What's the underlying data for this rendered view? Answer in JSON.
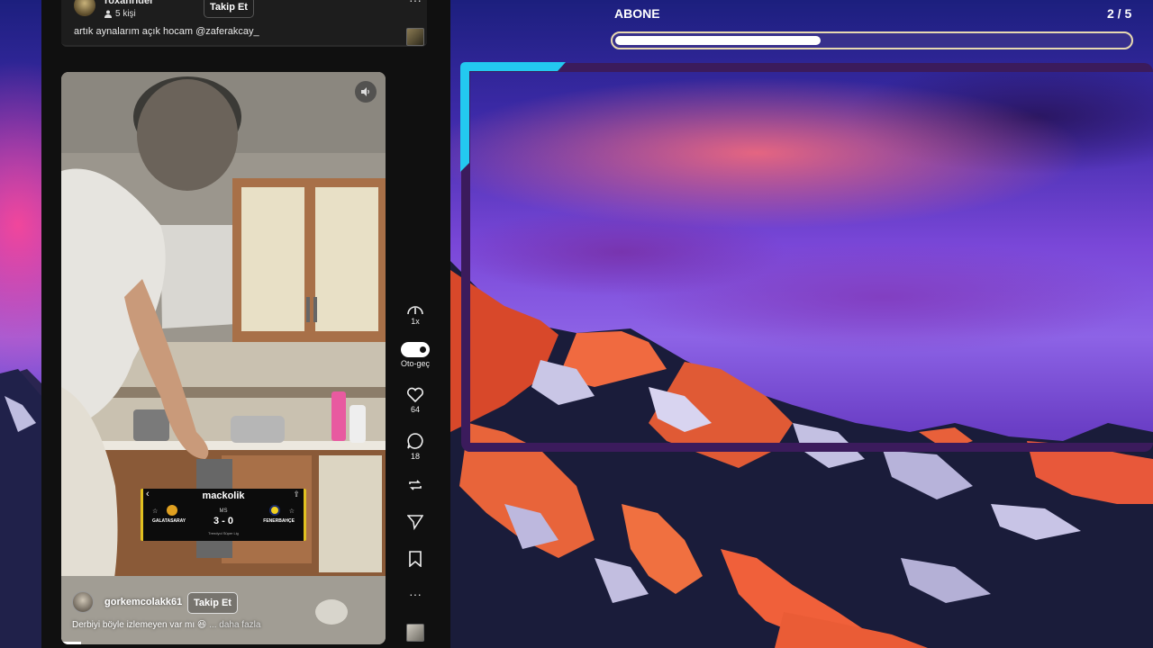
{
  "previous_post": {
    "username": "roxanrider",
    "followers": "5 kişi",
    "follow_label": "Takip Et",
    "caption": "artık aynalarım açık hocam @zaferakcay_"
  },
  "video": {
    "author": "gorkemcolakk61",
    "follow_label": "Takip Et",
    "caption": "Derbiyi böyle izlemeyen var mı 😆",
    "more_label": "... daha fazla",
    "progress": 0.06
  },
  "score_overlay": {
    "title": "mackolik",
    "status": "MS",
    "score": "3 - 0",
    "home_team": "GALATASARAY",
    "away_team": "FENERBAHÇE",
    "league": "Trendyol Süper Lig"
  },
  "action_rail": {
    "speed_label": "1x",
    "autoplay_label": "Oto-geç",
    "autoplay_on": true,
    "like_count": "64",
    "comment_count": "18"
  },
  "game": {
    "title": "ABONE",
    "counter": "2 / 5",
    "progress": 0.4
  },
  "colors": {
    "frame": "#3b1b5c",
    "frame_accent": "#23c9f0",
    "progress_border": "#e8d9b0",
    "overlay_accent": "#e0c020"
  }
}
